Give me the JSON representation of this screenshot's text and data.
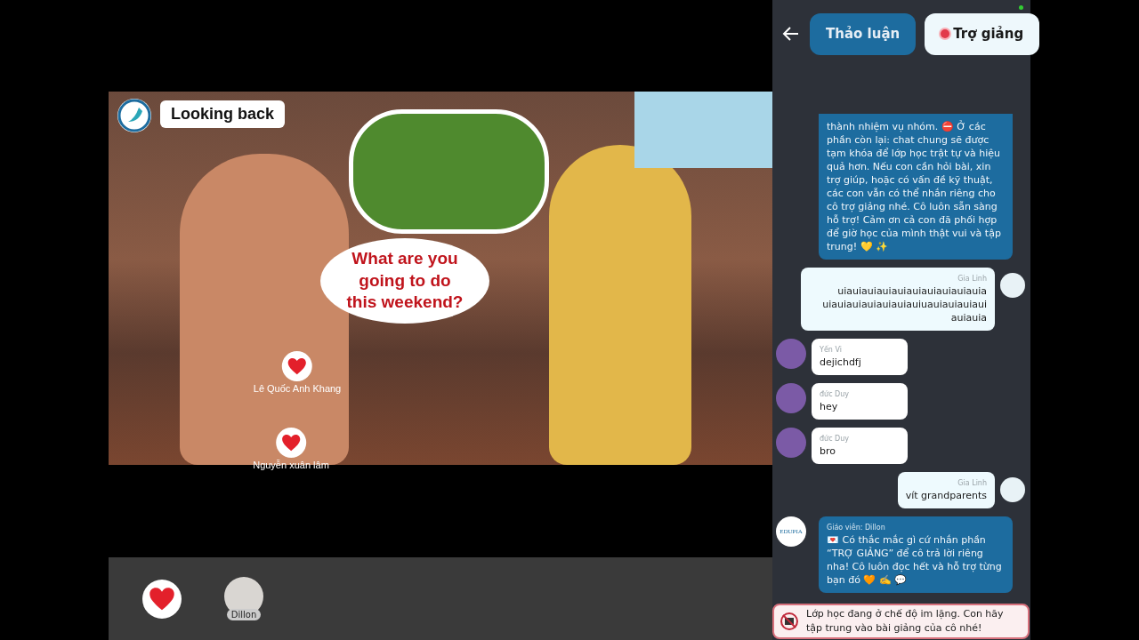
{
  "slide": {
    "title": "Looking back",
    "speech": "What are you going to do this weekend?",
    "reactions": [
      {
        "name": "Lê Quốc Anh Khang"
      },
      {
        "name": "Nguyễn xuân lâm"
      }
    ]
  },
  "participants": [
    {
      "kind": "reaction"
    },
    {
      "kind": "person",
      "name": "Dillon"
    }
  ],
  "chat": {
    "tabs": [
      {
        "label": "Thảo luận",
        "selected": false,
        "dot": false
      },
      {
        "label": "Trợ giảng",
        "selected": true,
        "dot": true
      }
    ],
    "messages": [
      {
        "kind": "teacher",
        "text": "thành nhiệm vụ nhóm. ⛔ Ở các phần còn lại: chat chung sẽ được tạm khóa để lớp học trật tự và hiệu quả hơn. Nếu con cần hỏi bài, xin trợ giúp, hoặc có vấn đề kỹ thuật, các con vẫn có thể nhắn riêng cho cô trợ giảng nhé. Cô luôn sẵn sàng hỗ trợ! Cảm ơn cả con đã phối hợp để giờ học của mình thật vui và tập trung! 💛 ✨",
        "cut": true
      },
      {
        "kind": "mine",
        "sender": "Gia Linh",
        "text": "uiauiauiauiauiauiauiauiauiauia uiauiauiauiauiauiauiuauiauiauiaui auiauia"
      },
      {
        "kind": "peer",
        "sender": "Yến Vi",
        "text": "dejichdfj"
      },
      {
        "kind": "peer",
        "sender": "đức Duy",
        "text": "hey"
      },
      {
        "kind": "peer",
        "sender": "đức Duy",
        "text": "bro"
      },
      {
        "kind": "mine",
        "sender": "Gia Linh",
        "text": "vít grandparents"
      },
      {
        "kind": "teacher",
        "sender": "Giáo viên: Dillon",
        "avatar": "EDUPIA",
        "text": "💌 Có thắc mắc gì cứ nhắn phần “TRỢ GIẢNG” để cô trả lời riêng nha! Cô luôn đọc hết và hỗ trợ từng bạn đó 🧡 ✍️ 💬"
      }
    ],
    "notice": "Lớp học đang ở chế độ im lặng. Con hãy tập trung vào bài giảng của cô nhé!"
  }
}
